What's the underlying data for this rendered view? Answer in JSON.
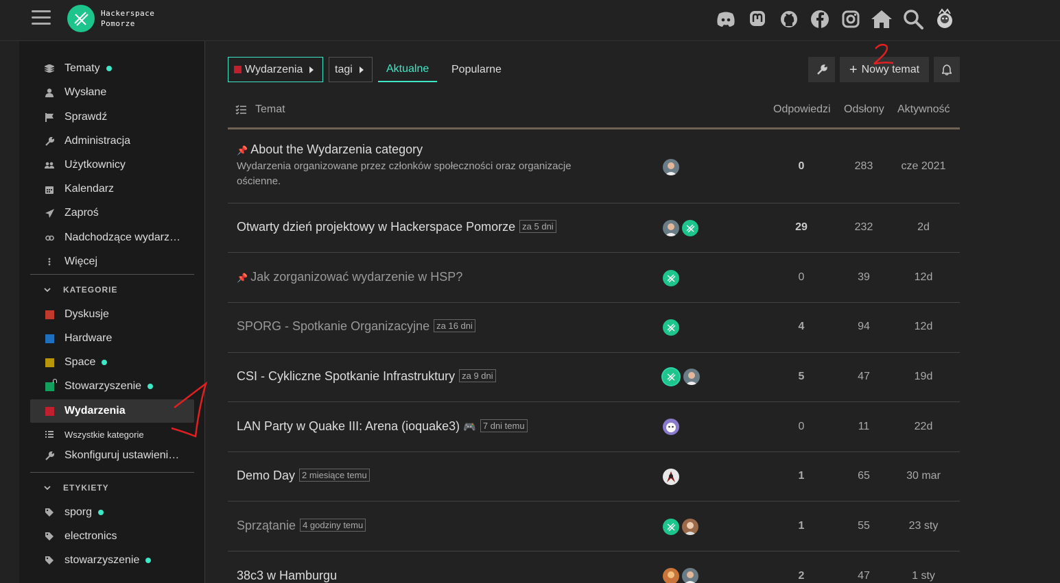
{
  "header": {
    "site_name_line1": "Hackerspace",
    "site_name_line2": "Pomorze",
    "icons": [
      "discord-icon",
      "mastodon-icon",
      "github-icon",
      "facebook-icon",
      "instagram-icon",
      "home-icon",
      "search-icon",
      "user-avatar"
    ]
  },
  "sidebar": {
    "items": [
      {
        "label": "Tematy",
        "icon": "layers-icon"
      },
      {
        "label": "Wysłane",
        "icon": "user-icon"
      },
      {
        "label": "Sprawdź",
        "icon": "flag-icon"
      },
      {
        "label": "Administracja",
        "icon": "wrench-icon"
      },
      {
        "label": "Użytkownicy",
        "icon": "users-icon"
      },
      {
        "label": "Kalendarz",
        "icon": "calendar-icon"
      },
      {
        "label": "Zaproś",
        "icon": "paper-plane-icon"
      },
      {
        "label": "Nadchodzące wydarz…",
        "icon": "link-icon"
      },
      {
        "label": "Więcej",
        "icon": "more-vertical-icon"
      }
    ],
    "categories_header": "KATEGORIE",
    "categories": [
      {
        "label": "Dyskusje",
        "color": "#c0392b"
      },
      {
        "label": "Hardware",
        "color": "#1f6fbf"
      },
      {
        "label": "Space",
        "color": "#b8960c"
      },
      {
        "label": "Stowarzyszenie",
        "color": "#12a05c"
      },
      {
        "label": "Wydarzenia",
        "color": "#c0202d"
      }
    ],
    "all_categories": "Wszystkie kategorie",
    "configure": "Skonfiguruj ustawieni…",
    "tags_header": "ETYKIETY",
    "tags": [
      {
        "label": "sporg"
      },
      {
        "label": "electronics"
      },
      {
        "label": "stowarzyszenie"
      }
    ]
  },
  "navigation": {
    "category_crumb": "Wydarzenia",
    "category_color": "#c0202d",
    "tags_crumb": "tagi",
    "tab_latest": "Aktualne",
    "tab_top": "Popularne",
    "new_topic": "Nowy temat"
  },
  "table": {
    "col_topic": "Temat",
    "col_replies": "Odpowiedzi",
    "col_views": "Odsłony",
    "col_activity": "Aktywność"
  },
  "topics": [
    {
      "title": "About the Wydarzenia category",
      "pinned": true,
      "excerpt": "Wydarzenia organizowane przez członków społeczności oraz organizacje ościenne.",
      "replies": "0",
      "views": "283",
      "activity": "cze 2021"
    },
    {
      "title": "Otwarty dzień projektowy w Hackerspace Pomorze",
      "badge": "za 5 dni",
      "replies": "29",
      "views": "232",
      "activity": "2d"
    },
    {
      "title": "Jak zorganizować wydarzenie w HSP?",
      "replies": "0",
      "views": "39",
      "activity": "12d"
    },
    {
      "title": "SPORG - Spotkanie Organizacyjne",
      "badge": "za 16 dni",
      "replies": "4",
      "views": "94",
      "activity": "12d"
    },
    {
      "title": "CSI - Cykliczne Spotkanie Infrastruktury",
      "badge": "za 9 dni",
      "replies": "5",
      "views": "47",
      "activity": "19d"
    },
    {
      "title": "LAN Party w Quake III: Arena (ioquake3)",
      "badge": "7 dni temu",
      "emoji": "🎮",
      "replies": "0",
      "views": "11",
      "activity": "22d"
    },
    {
      "title": "Demo Day",
      "badge": "2 miesiące temu",
      "replies": "1",
      "views": "65",
      "activity": "30 mar"
    },
    {
      "title": "Sprzątanie",
      "badge": "4 godziny temu",
      "replies": "1",
      "views": "55",
      "activity": "23 sty"
    },
    {
      "title": "38c3 w Hamburgu",
      "replies": "2",
      "views": "47",
      "activity": "1 sty"
    }
  ]
}
